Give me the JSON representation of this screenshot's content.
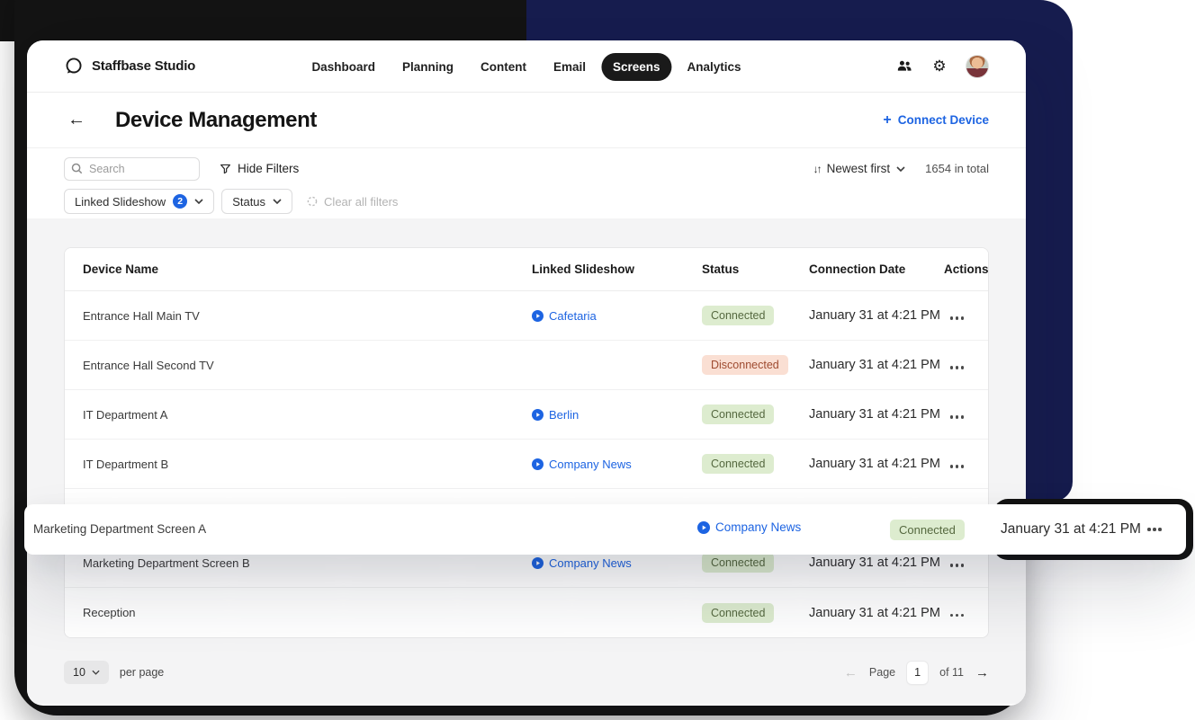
{
  "header": {
    "brand": "Staffbase Studio",
    "nav": [
      {
        "label": "Dashboard"
      },
      {
        "label": "Planning"
      },
      {
        "label": "Content"
      },
      {
        "label": "Email"
      },
      {
        "label": "Screens",
        "active": true
      },
      {
        "label": "Analytics"
      }
    ]
  },
  "page": {
    "title": "Device Management",
    "connect_device": "Connect Device"
  },
  "toolbar": {
    "search_placeholder": "Search",
    "hide_filters": "Hide Filters",
    "sort_label": "Newest first",
    "total": "1654 in total"
  },
  "filters": {
    "linked_slideshow_label": "Linked Slideshow",
    "linked_slideshow_count": "2",
    "status_label": "Status",
    "clear_label": "Clear all filters"
  },
  "table": {
    "headers": [
      "Device Name",
      "Linked Slideshow",
      "Status",
      "Connection Date",
      "Actions"
    ],
    "rows": [
      {
        "name": "Entrance Hall Main TV",
        "slideshow": "Cafetaria",
        "status": "Connected",
        "date": "January 31 at 4:21 PM"
      },
      {
        "name": "Entrance Hall Second TV",
        "slideshow": "",
        "status": "Disconnected",
        "date": "January 31 at 4:21 PM"
      },
      {
        "name": "IT Department A",
        "slideshow": "Berlin",
        "status": "Connected",
        "date": "January 31 at 4:21 PM"
      },
      {
        "name": "IT Department B",
        "slideshow": "Company News",
        "status": "Connected",
        "date": "January 31 at 4:21 PM"
      },
      {
        "name": "Marketing Department Screen A",
        "slideshow": "Company News",
        "status": "Connected",
        "date": "January 31 at 4:21 PM",
        "floating": true
      },
      {
        "name": "Marketing Department Screen B",
        "slideshow": "Company News",
        "status": "Connected",
        "date": "January 31 at 4:21 PM"
      },
      {
        "name": "Reception",
        "slideshow": "",
        "status": "Connected",
        "date": "January 31 at 4:21 PM"
      }
    ]
  },
  "footer": {
    "page_size": "10",
    "per_page_label": "per page",
    "page_label": "Page",
    "current_page": "1",
    "total_pages_label": "of 11"
  },
  "icons": {
    "back": "←",
    "plus": "+",
    "sort": "↓↑",
    "gear": "⚙",
    "prev": "←",
    "next": "→"
  },
  "colors": {
    "brand_navy": "#161c4e",
    "accent_blue": "#1d64e2",
    "active_pill": "#1a1a1a",
    "connected_bg": "#ddeccf",
    "connected_text": "#55683f",
    "disconnected_bg": "#fadfd3",
    "disconnected_text": "#9f4b30"
  }
}
